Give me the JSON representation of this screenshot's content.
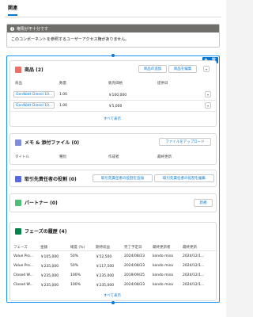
{
  "tabs": {
    "related": "関連"
  },
  "alert": {
    "header": "権限が不十分です",
    "body": "このコンポーネントを参照するユーザーアクセス権がありません。"
  },
  "products": {
    "title": "商品 (2)",
    "btn_add": "商品の追加",
    "btn_edit": "商品を編集",
    "columns": [
      "商品",
      "数量",
      "販売価格",
      "提供日"
    ],
    "rows": [
      {
        "name": "GenWatt Diesel 10...",
        "qty": "1.00",
        "price": "￥100,000"
      },
      {
        "name": "GenWatt Diesel 10...",
        "qty": "1.00",
        "price": "￥5,000"
      }
    ],
    "view_all": "すべて表示",
    "colors": {
      "icon": "#ef6e64"
    }
  },
  "memo": {
    "title": "メモ & 添付ファイル (0)",
    "btn_upload": "ファイルをアップロード",
    "columns": [
      "タイトル",
      "種別",
      "作成者",
      "最終更新"
    ],
    "colors": {
      "icon": "#7f8de1"
    }
  },
  "contact_roles": {
    "title": "取引先責任者の役割 (0)",
    "btn_add": "取引先責任者の役割を追加",
    "btn_edit": "取引先責任者の役割を編集",
    "colors": {
      "icon": "#5867e8"
    }
  },
  "partners": {
    "title": "パートナー (0)",
    "btn_new": "新規",
    "colors": {
      "icon": "#4bc076"
    }
  },
  "history": {
    "title": "フェーズの履歴 (4)",
    "columns": [
      "フェーズ",
      "金額",
      "確度 (%)",
      "期待収益",
      "完了予定日",
      "最終更新者",
      "最終更新"
    ],
    "rows": [
      [
        "Value Pro...",
        "￥105,000",
        "50%",
        "￥52,500",
        "2024/08/23",
        "kondo misa",
        "2024/12/1..."
      ],
      [
        "Value Pro...",
        "￥235,000",
        "50%",
        "￥117,500",
        "2024/08/23",
        "kondo misa",
        "2024/12/1..."
      ],
      [
        "Closed W...",
        "￥235,000",
        "100%",
        "￥235,000",
        "2019/09/25",
        "kondo misa",
        "2024/12/1..."
      ],
      [
        "Closed W...",
        "￥235,000",
        "100%",
        "￥235,000",
        "2024/08/23",
        "kondo misa",
        "2024/12/1..."
      ]
    ],
    "view_all": "すべて表示",
    "colors": {
      "icon": "#04844b"
    }
  },
  "colors": {
    "accent": "#0176d3",
    "frame": "#1b96ff"
  }
}
